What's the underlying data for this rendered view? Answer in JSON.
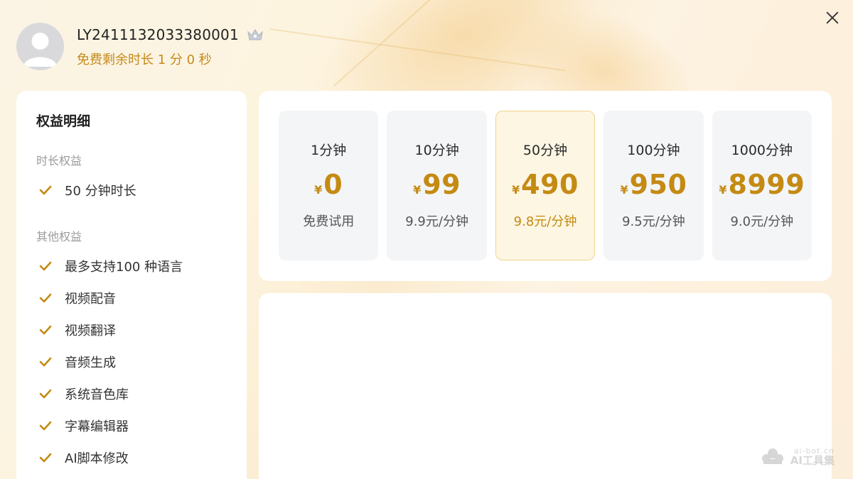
{
  "user": {
    "name": "LY2411132033380001",
    "free_time": "免费剩余时长 1 分 0 秒",
    "avatar_icon": "user-avatar-icon",
    "badge_icon": "crown-icon"
  },
  "benefits": {
    "title": "权益明细",
    "duration_section": {
      "label": "时长权益",
      "items": [
        "50 分钟时长"
      ]
    },
    "other_section": {
      "label": "其他权益",
      "items": [
        "最多支持100 种语言",
        "视频配音",
        "视频翻译",
        "音频生成",
        "系统音色库",
        "字幕编辑器",
        "AI脚本修改"
      ]
    }
  },
  "plans": [
    {
      "duration": "1分钟",
      "currency": "¥",
      "price": "0",
      "unit": "免费试用",
      "selected": false
    },
    {
      "duration": "10分钟",
      "currency": "¥",
      "price": "99",
      "unit": "9.9元/分钟",
      "selected": false
    },
    {
      "duration": "50分钟",
      "currency": "¥",
      "price": "490",
      "unit": "9.8元/分钟",
      "selected": true
    },
    {
      "duration": "100分钟",
      "currency": "¥",
      "price": "950",
      "unit": "9.5元/分钟",
      "selected": false
    },
    {
      "duration": "1000分钟",
      "currency": "¥",
      "price": "8999",
      "unit": "9.0元/分钟",
      "selected": false
    }
  ],
  "watermark": {
    "url": "ai-bot.cn",
    "name": "AI工具集"
  },
  "colors": {
    "accent": "#c48a12",
    "selected_bg": "#fdf6e3",
    "selected_border": "#efd48c",
    "card_bg": "#f4f5f7"
  }
}
